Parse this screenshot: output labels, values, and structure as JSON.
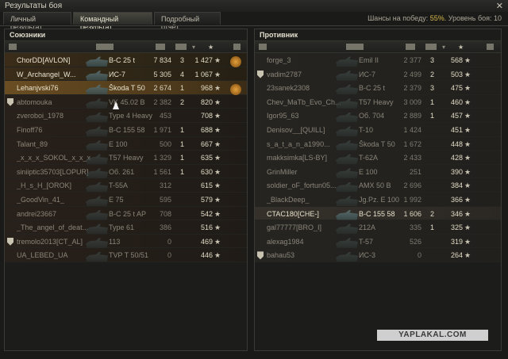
{
  "window": {
    "title": "Результаты боя"
  },
  "tabs": [
    {
      "label": "Личный результат"
    },
    {
      "label": "Командный результат"
    },
    {
      "label": "Подробный отчёт"
    }
  ],
  "win_chance": {
    "prefix": "Шансы на победу:",
    "value": "55%.",
    "level_text": "Уровень боя: 10"
  },
  "allies": {
    "title": "Союзники",
    "rows": [
      {
        "name": "ChorDD[AVLON]",
        "tank": "B-C 25 t",
        "damage": "7 834",
        "kills": "3",
        "xp": "1 427",
        "state": "alive",
        "medal": true
      },
      {
        "name": "W_Archangel_W...",
        "tank": "ИС-7",
        "damage": "5 305",
        "kills": "4",
        "xp": "1 067",
        "state": "alive"
      },
      {
        "name": "Lehanjvski76",
        "tank": "Škoda T 50",
        "damage": "2 674",
        "kills": "1",
        "xp": "968",
        "state": "me",
        "medal": true
      },
      {
        "name": "abtomouka",
        "tank": "VK 45.02 B",
        "damage": "2 382",
        "kills": "2",
        "xp": "820",
        "state": "dead",
        "clan": true
      },
      {
        "name": "zveroboi_1978",
        "tank": "Type 4 Heavy",
        "damage": "453",
        "kills": "",
        "xp": "708",
        "state": "dead"
      },
      {
        "name": "Finoff76",
        "tank": "B-C 155 58",
        "damage": "1 971",
        "kills": "1",
        "xp": "688",
        "state": "dead"
      },
      {
        "name": "Talant_89",
        "tank": "E 100",
        "damage": "500",
        "kills": "1",
        "xp": "667",
        "state": "dead"
      },
      {
        "name": "_x_x_x_SOKOL_x_x_x",
        "tank": "T57 Heavy",
        "damage": "1 329",
        "kills": "1",
        "xp": "635",
        "state": "dead"
      },
      {
        "name": "siniiptic35703[LOPUR]",
        "tank": "Об. 261",
        "damage": "1 561",
        "kills": "1",
        "xp": "630",
        "state": "dead"
      },
      {
        "name": "_H_s_H_[OROK]",
        "tank": "T-55A",
        "damage": "312",
        "kills": "",
        "xp": "615",
        "state": "dead"
      },
      {
        "name": "_GoodVin_41_",
        "tank": "E 75",
        "damage": "595",
        "kills": "",
        "xp": "579",
        "state": "dead"
      },
      {
        "name": "andrei23667",
        "tank": "B-C 25 t AP",
        "damage": "708",
        "kills": "",
        "xp": "542",
        "state": "dead"
      },
      {
        "name": "_The_angel_of_deat...",
        "tank": "Type 61",
        "damage": "386",
        "kills": "",
        "xp": "516",
        "state": "dead"
      },
      {
        "name": "tremolo2013[CT_AL]",
        "tank": "113",
        "damage": "0",
        "kills": "",
        "xp": "469",
        "state": "dead",
        "clan": true
      },
      {
        "name": "UA_LEBED_UA",
        "tank": "TVP T 50/51",
        "damage": "0",
        "kills": "",
        "xp": "446",
        "state": "dead"
      }
    ]
  },
  "enemies": {
    "title": "Противник",
    "rows": [
      {
        "name": "forge_3",
        "tank": "Emil II",
        "damage": "2 377",
        "kills": "3",
        "xp": "568",
        "state": "enemy-dead"
      },
      {
        "name": "vadim2787",
        "tank": "ИС-7",
        "damage": "2 499",
        "kills": "2",
        "xp": "503",
        "state": "enemy-dead",
        "clan": true
      },
      {
        "name": "23sanek2308",
        "tank": "B-C 25 t",
        "damage": "2 379",
        "kills": "3",
        "xp": "475",
        "state": "enemy-dead"
      },
      {
        "name": "Chev_MaTb_Evo_Ch...",
        "tank": "T57 Heavy",
        "damage": "3 009",
        "kills": "1",
        "xp": "460",
        "state": "enemy-dead"
      },
      {
        "name": "Igor95_63",
        "tank": "Об. 704",
        "damage": "2 889",
        "kills": "1",
        "xp": "457",
        "state": "enemy-dead"
      },
      {
        "name": "Denisov__[QUILL]",
        "tank": "T-10",
        "damage": "1 424",
        "kills": "",
        "xp": "451",
        "state": "enemy-dead"
      },
      {
        "name": "s_a_t_a_n_a1990...",
        "tank": "Škoda T 50",
        "damage": "1 672",
        "kills": "",
        "xp": "448",
        "state": "enemy-dead"
      },
      {
        "name": "makksimka[LS-BY]",
        "tank": "T-62A",
        "damage": "2 433",
        "kills": "",
        "xp": "428",
        "state": "enemy-dead"
      },
      {
        "name": "GrinMiller",
        "tank": "E 100",
        "damage": "251",
        "kills": "",
        "xp": "390",
        "state": "enemy-dead"
      },
      {
        "name": "soldier_oF_fortun05...",
        "tank": "AMX 50 B",
        "damage": "2 696",
        "kills": "",
        "xp": "384",
        "state": "enemy-dead"
      },
      {
        "name": "_BlackDeep_",
        "tank": "Jg.Pz. E 100",
        "damage": "1 992",
        "kills": "",
        "xp": "366",
        "state": "enemy-dead"
      },
      {
        "name": "CTAC180[CHE-]",
        "tank": "B-C 155 58",
        "damage": "1 606",
        "kills": "2",
        "xp": "346",
        "state": "enemy-alive"
      },
      {
        "name": "gal77777[BRO_I]",
        "tank": "212A",
        "damage": "335",
        "kills": "1",
        "xp": "325",
        "state": "enemy-dead"
      },
      {
        "name": "alexag1984",
        "tank": "T-57",
        "damage": "526",
        "kills": "",
        "xp": "319",
        "state": "enemy-dead"
      },
      {
        "name": "bahau53",
        "tank": "ИС-3",
        "damage": "0",
        "kills": "",
        "xp": "264",
        "state": "enemy-dead",
        "clan": true
      }
    ]
  },
  "star_glyph": "★",
  "watermark": "YAPLAKAL.COM"
}
